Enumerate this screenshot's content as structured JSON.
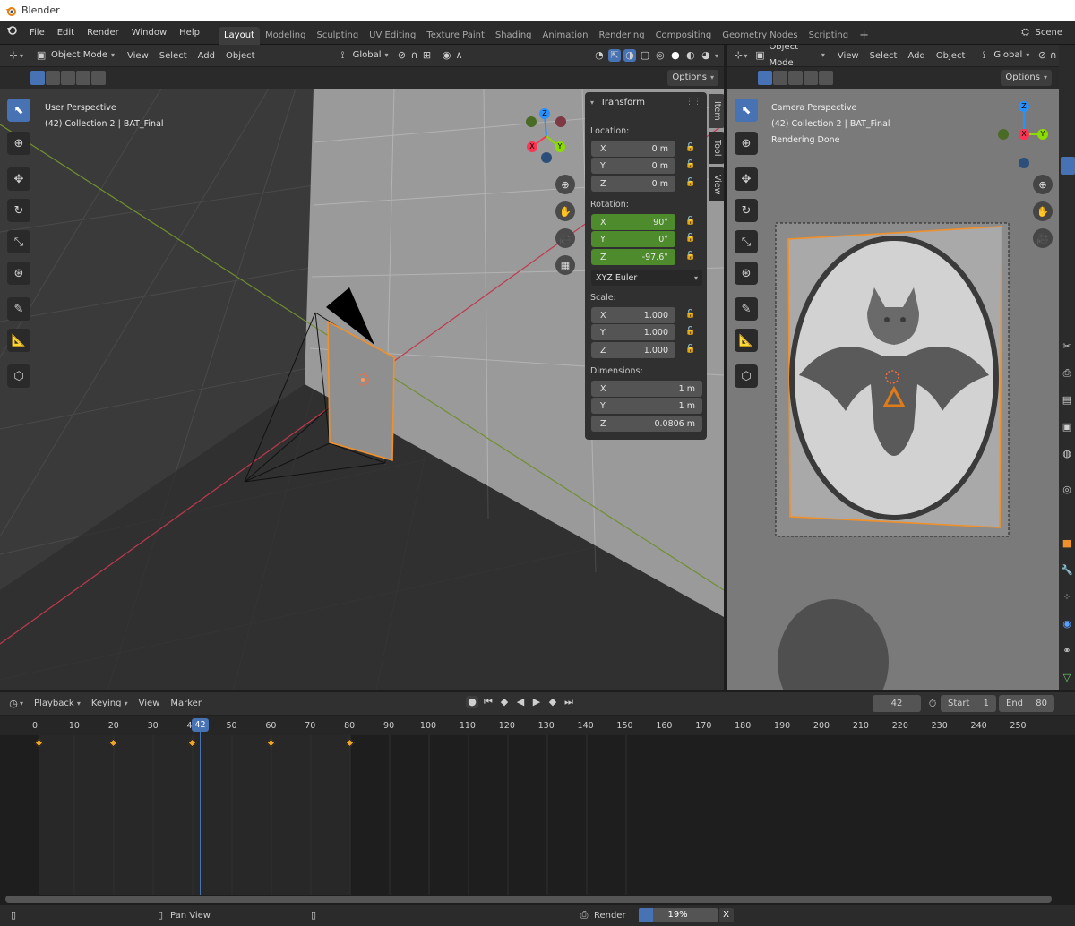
{
  "app": {
    "title": "Blender"
  },
  "menu": [
    "File",
    "Edit",
    "Render",
    "Window",
    "Help"
  ],
  "workspaces": [
    "Layout",
    "Modeling",
    "Sculpting",
    "UV Editing",
    "Texture Paint",
    "Shading",
    "Animation",
    "Rendering",
    "Compositing",
    "Geometry Nodes",
    "Scripting"
  ],
  "workspace_add": "+",
  "scene": "Scene",
  "viewport_left": {
    "mode": "Object Mode",
    "menus": [
      "View",
      "Select",
      "Add",
      "Object"
    ],
    "orientation": "Global",
    "options": "Options",
    "overlay_line1": "User Perspective",
    "overlay_line2": "(42) Collection 2 | BAT_Final"
  },
  "viewport_right": {
    "mode": "Object Mode",
    "menus": [
      "View",
      "Select",
      "Add",
      "Object"
    ],
    "orientation": "Global",
    "options": "Options",
    "overlay_line1": "Camera Perspective",
    "overlay_line2": "(42) Collection 2 | BAT_Final",
    "overlay_line3": "Rendering Done"
  },
  "gizmo_axes": {
    "x": "X",
    "y": "Y",
    "z": "Z"
  },
  "npanel": {
    "tabs": [
      "Item",
      "Tool",
      "View"
    ],
    "header": "Transform",
    "location_label": "Location:",
    "location": [
      {
        "axis": "X",
        "value": "0 m"
      },
      {
        "axis": "Y",
        "value": "0 m"
      },
      {
        "axis": "Z",
        "value": "0 m"
      }
    ],
    "rotation_label": "Rotation:",
    "rotation": [
      {
        "axis": "X",
        "value": "90°"
      },
      {
        "axis": "Y",
        "value": "0°"
      },
      {
        "axis": "Z",
        "value": "-97.6°"
      }
    ],
    "rotation_mode": "XYZ Euler",
    "scale_label": "Scale:",
    "scale": [
      {
        "axis": "X",
        "value": "1.000"
      },
      {
        "axis": "Y",
        "value": "1.000"
      },
      {
        "axis": "Z",
        "value": "1.000"
      }
    ],
    "dimensions_label": "Dimensions:",
    "dimensions": [
      {
        "axis": "X",
        "value": "1 m"
      },
      {
        "axis": "Y",
        "value": "1 m"
      },
      {
        "axis": "Z",
        "value": "0.0806 m"
      }
    ]
  },
  "timeline": {
    "menus": [
      "Playback",
      "Keying",
      "View",
      "Marker"
    ],
    "current_frame": "42",
    "start_label": "Start",
    "start": "1",
    "end_label": "End",
    "end": "80",
    "ticks": [
      "0",
      "10",
      "20",
      "30",
      "40",
      "50",
      "60",
      "70",
      "80",
      "90",
      "100",
      "110",
      "120",
      "130",
      "140",
      "150",
      "160",
      "170",
      "180",
      "190",
      "200",
      "210",
      "220",
      "230",
      "240",
      "250"
    ],
    "keyframes": [
      1,
      20,
      40,
      60,
      80
    ]
  },
  "status": {
    "pan_view": "Pan View",
    "render_label": "Render",
    "render_progress": "19%",
    "render_progress_value": 0.19,
    "cancel": "X"
  },
  "colors": {
    "accent": "#4772b3",
    "keyframe": "#f0a623",
    "selected_outline": "#f0902a",
    "axis_x": "#ff3352",
    "axis_y": "#8bdc00",
    "axis_z": "#2890ff"
  }
}
